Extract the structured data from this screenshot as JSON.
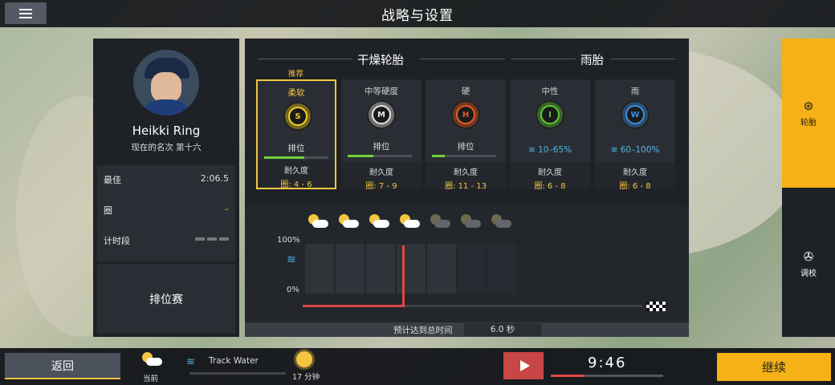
{
  "header": {
    "title": "战略与设置"
  },
  "driver": {
    "name": "Heikki Ring",
    "position_label": "现在的名次 第十六",
    "stats": {
      "best_label": "最佳",
      "best_value": "2:06.5",
      "lap_label": "圈",
      "lap_value": "–",
      "sector_label": "计时段"
    },
    "session": "排位赛"
  },
  "tyres": {
    "dry_label": "干燥轮胎",
    "wet_label": "雨胎",
    "recommend_label": "推荐",
    "durability_label": "耐久度",
    "items": [
      {
        "name": "柔软",
        "letter": "S",
        "color": "#f5d020",
        "perf_label": "排位",
        "perf": 0.62,
        "laps": "圈: 4 - 6",
        "selected": true
      },
      {
        "name": "中等硬度",
        "letter": "M",
        "color": "#e5e5e5",
        "perf_label": "排位",
        "perf": 0.4,
        "laps": "圈: 7 - 9"
      },
      {
        "name": "硬",
        "letter": "H",
        "color": "#ee5a24",
        "perf_label": "排位",
        "perf": 0.2,
        "laps": "圈: 11 - 13"
      },
      {
        "name": "中性",
        "letter": "I",
        "color": "#5ccb35",
        "water": "10–65%",
        "laps": "圈: 6 - 8"
      },
      {
        "name": "雨",
        "letter": "W",
        "color": "#3a8fe0",
        "water": "60–100%",
        "laps": "圈: 6 - 8"
      }
    ]
  },
  "forecast": {
    "y_max_label": "100%",
    "y_min_label": "0%",
    "eta_label": "预计达到总时间",
    "eta_value": "6.0 秒",
    "icons": [
      "sun-cloud",
      "sun-cloud",
      "sun-cloud",
      "sun-cloud",
      "sun-cloud-dim",
      "sun-cloud-dim",
      "sun-cloud-dim"
    ]
  },
  "side_tabs": [
    {
      "label": "轮胎",
      "icon": "tyre-icon",
      "active": true
    },
    {
      "label": "调校",
      "icon": "wrench-icon"
    }
  ],
  "bottom": {
    "back_label": "返回",
    "current_label": "当前",
    "track_water_label": "Track Water",
    "time_label": "17 分钟",
    "clock": "9:46",
    "clock_progress": 0.3,
    "continue_label": "继续"
  },
  "colors": {
    "accent": "#f6b116",
    "play": "#c84646",
    "water": "#53b4e6"
  }
}
